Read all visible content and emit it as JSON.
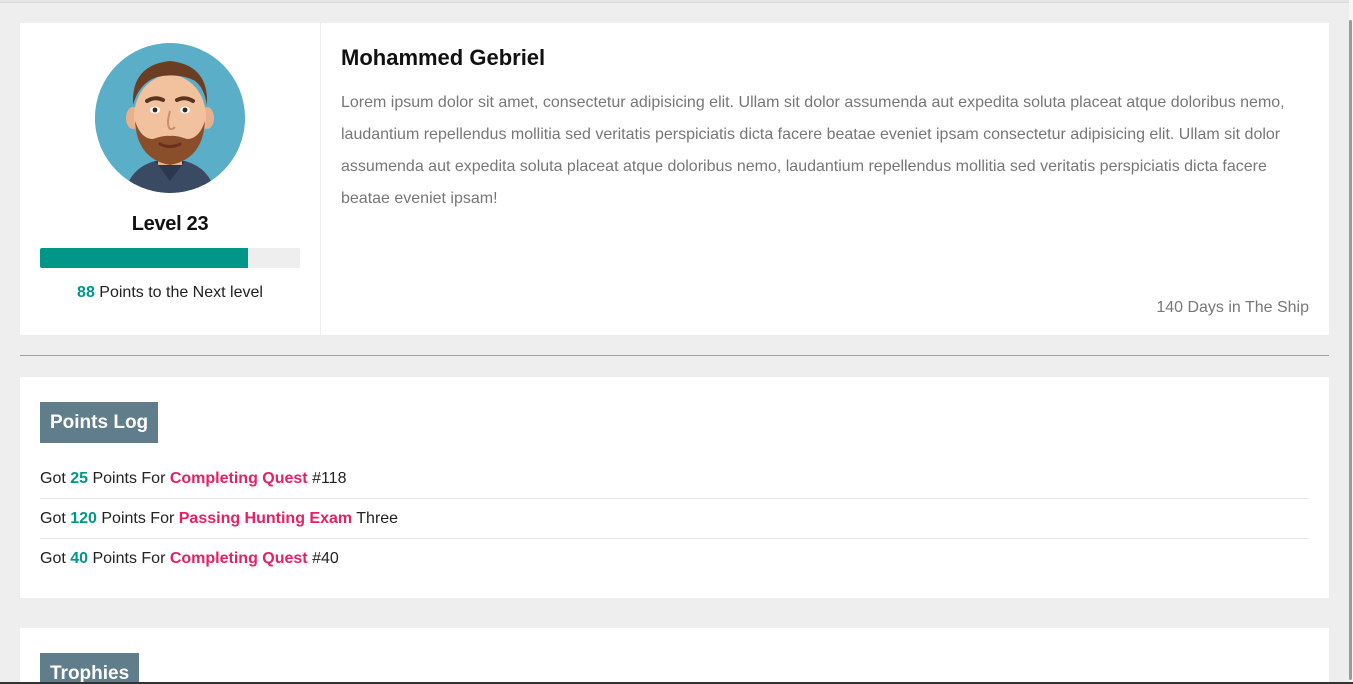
{
  "profile": {
    "name": "Mohammed Gebriel",
    "level_label": "Level 23",
    "progress_fraction": 0.8,
    "points_to_next_value": "88",
    "points_to_next_label": " Points to the Next level",
    "bio": "Lorem ipsum dolor sit amet, consectetur adipisicing elit. Ullam sit dolor assumenda aut expedita soluta placeat atque doloribus nemo, laudantium repellendus mollitia sed veritatis perspiciatis dicta facere beatae eveniet ipsam consectetur adipisicing elit. Ullam sit dolor assumenda aut expedita soluta placeat atque doloribus nemo, laudantium repellendus mollitia sed veritatis perspiciatis dicta facere beatae eveniet ipsam!",
    "days_in_ship": "140 Days in The Ship",
    "avatar_icon": "bearded-man-avatar-icon"
  },
  "points_log": {
    "title": "Points Log",
    "items": [
      {
        "prefix": "Got ",
        "points": "25",
        "middle": " Points For ",
        "action": "Completing Quest",
        "suffix": " #118"
      },
      {
        "prefix": "Got ",
        "points": "120",
        "middle": " Points For ",
        "action": "Passing Hunting Exam",
        "suffix": " Three"
      },
      {
        "prefix": "Got ",
        "points": "40",
        "middle": " Points For ",
        "action": "Completing Quest",
        "suffix": " #40"
      }
    ]
  },
  "trophies": {
    "title": "Trophies"
  },
  "colors": {
    "accent": "#009688",
    "highlight": "#e91e63",
    "tag_bg": "#607d8b",
    "page_bg": "#eeeeee"
  }
}
